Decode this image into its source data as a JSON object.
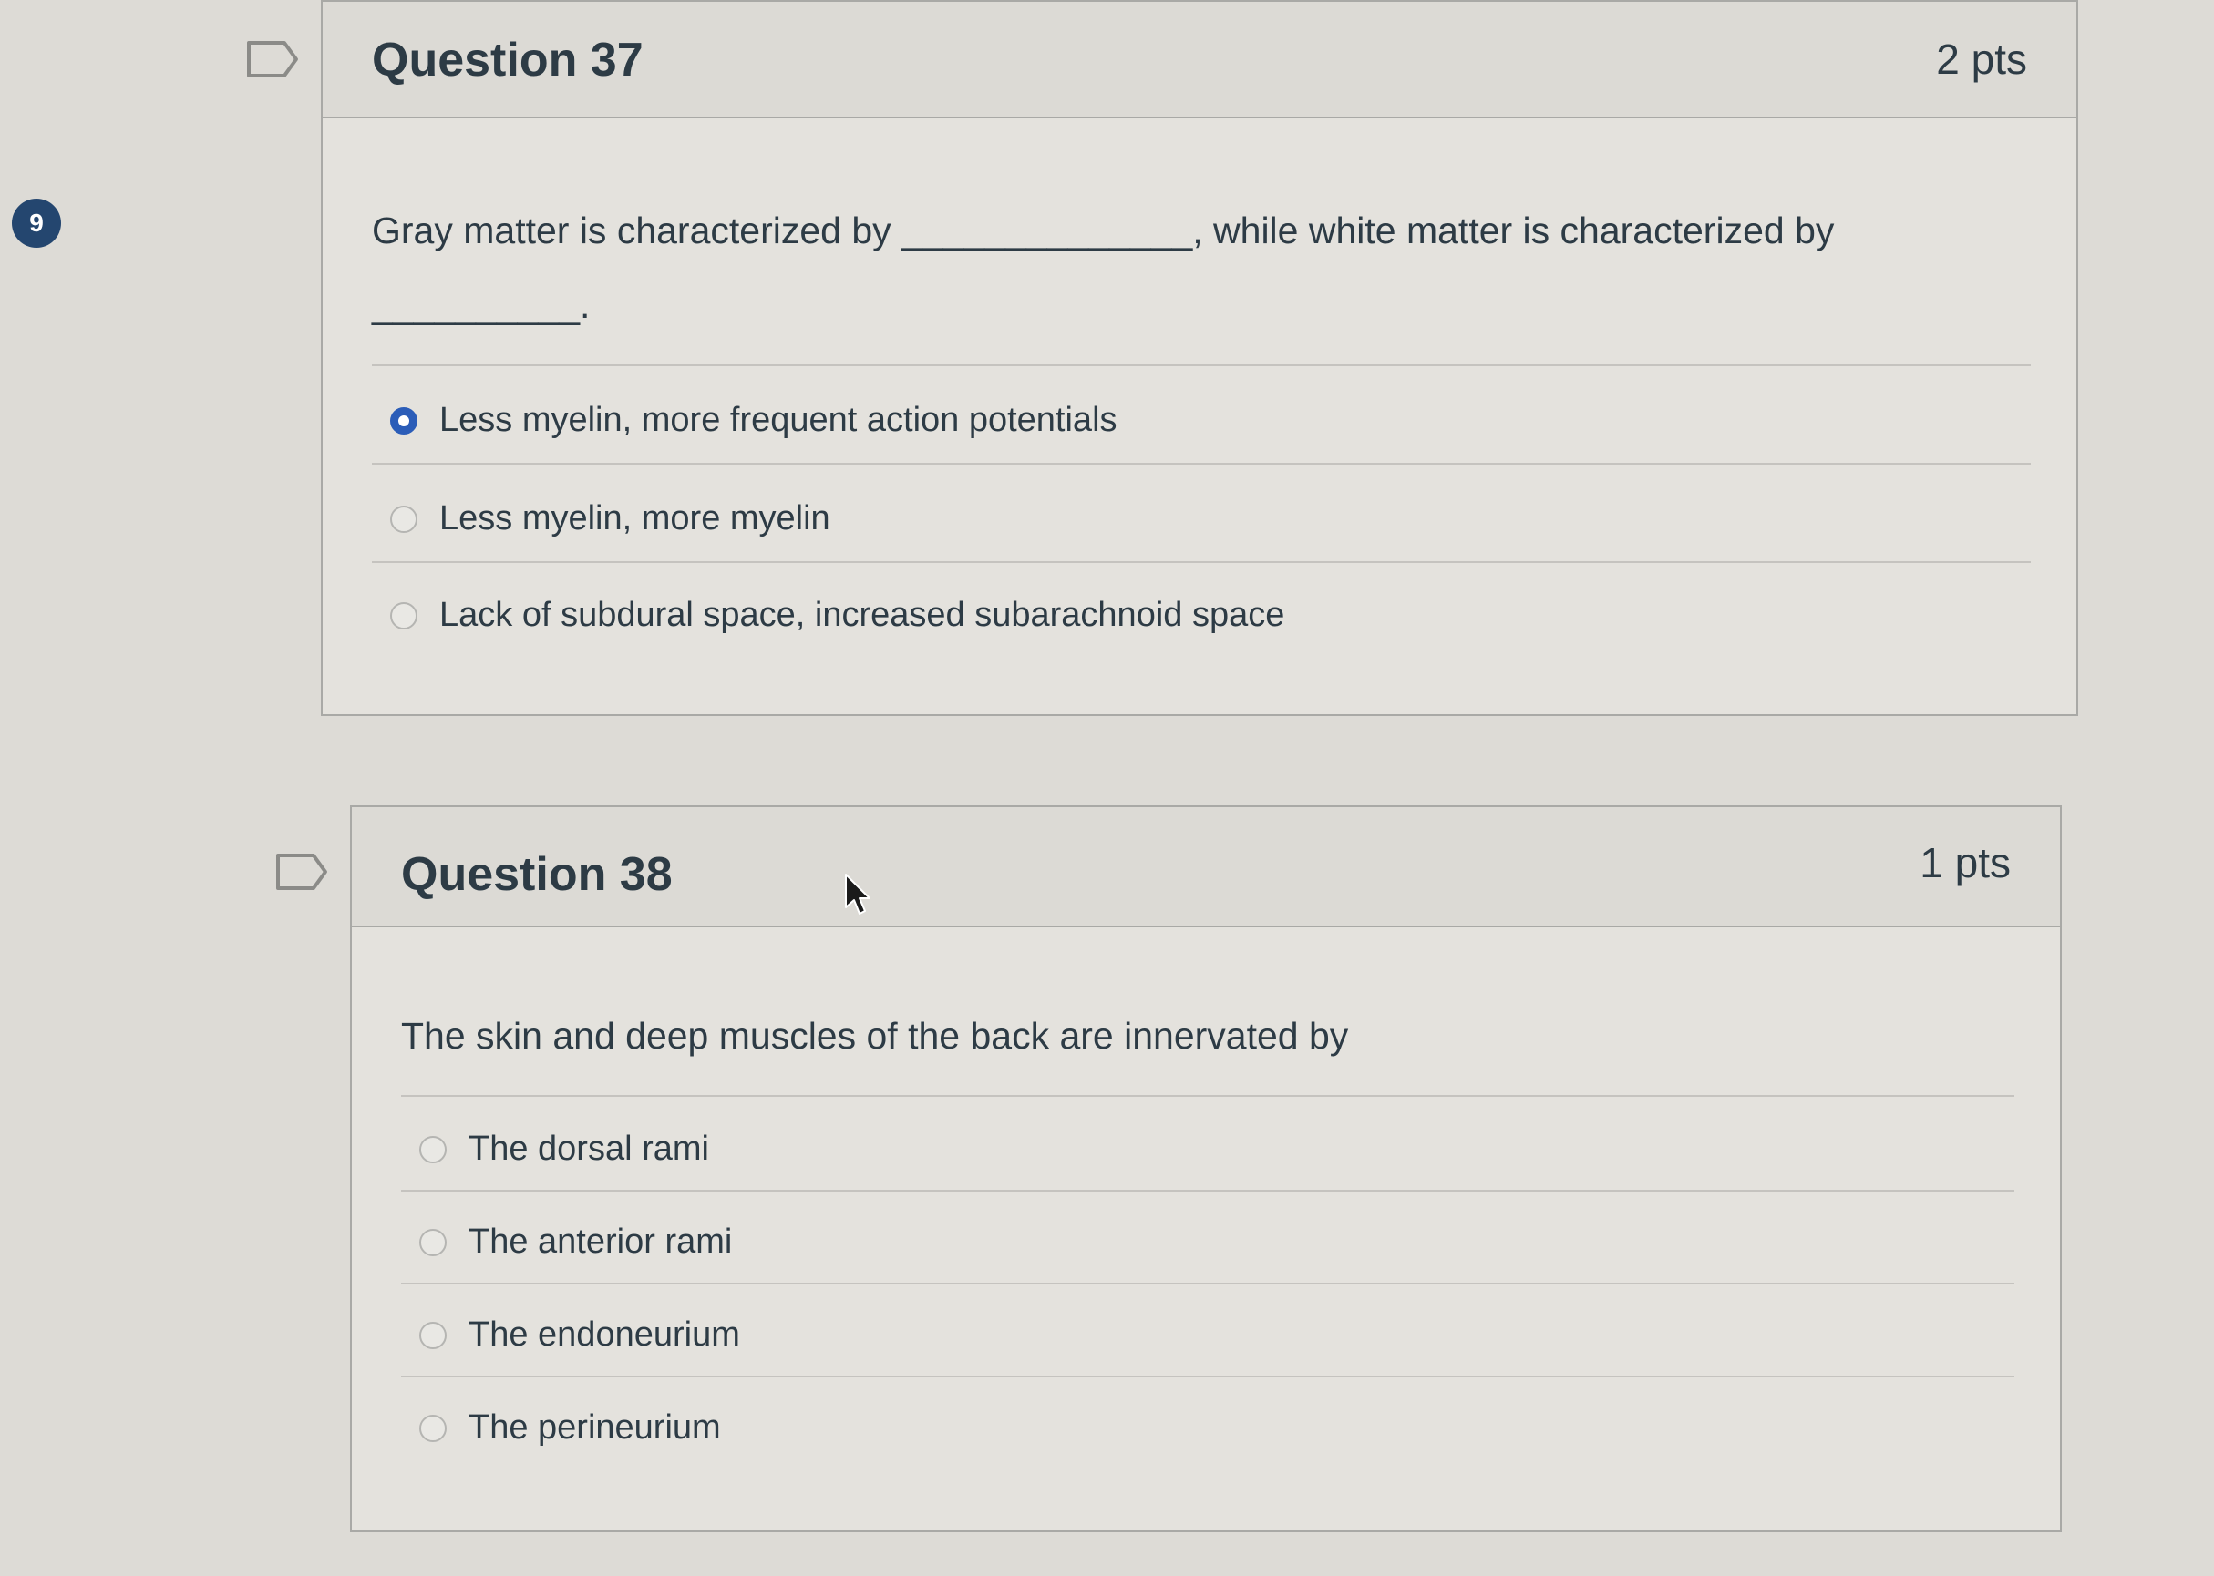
{
  "badge": {
    "count": "9"
  },
  "questions": [
    {
      "title": "Question 37",
      "points": "2 pts",
      "text": "Gray matter is characterized by ______________, while white matter is characterized by __________.",
      "answers": [
        {
          "label": "Less myelin, more frequent action potentials",
          "selected": true
        },
        {
          "label": "Less myelin, more myelin",
          "selected": false
        },
        {
          "label": "Lack of subdural space, increased subarachnoid space",
          "selected": false
        }
      ]
    },
    {
      "title": "Question 38",
      "points": "1 pts",
      "text": "The skin and deep muscles of the back are innervated by",
      "answers": [
        {
          "label": "The dorsal rami",
          "selected": false
        },
        {
          "label": "The anterior rami",
          "selected": false
        },
        {
          "label": "The endoneurium",
          "selected": false
        },
        {
          "label": "The perineurium",
          "selected": false
        }
      ]
    }
  ],
  "colors": {
    "selected_radio": "#2b5db8",
    "badge": "#24466f",
    "text": "#2d3b45"
  },
  "icons": [
    "flag-icon",
    "radio-icon",
    "mouse-cursor-icon"
  ]
}
